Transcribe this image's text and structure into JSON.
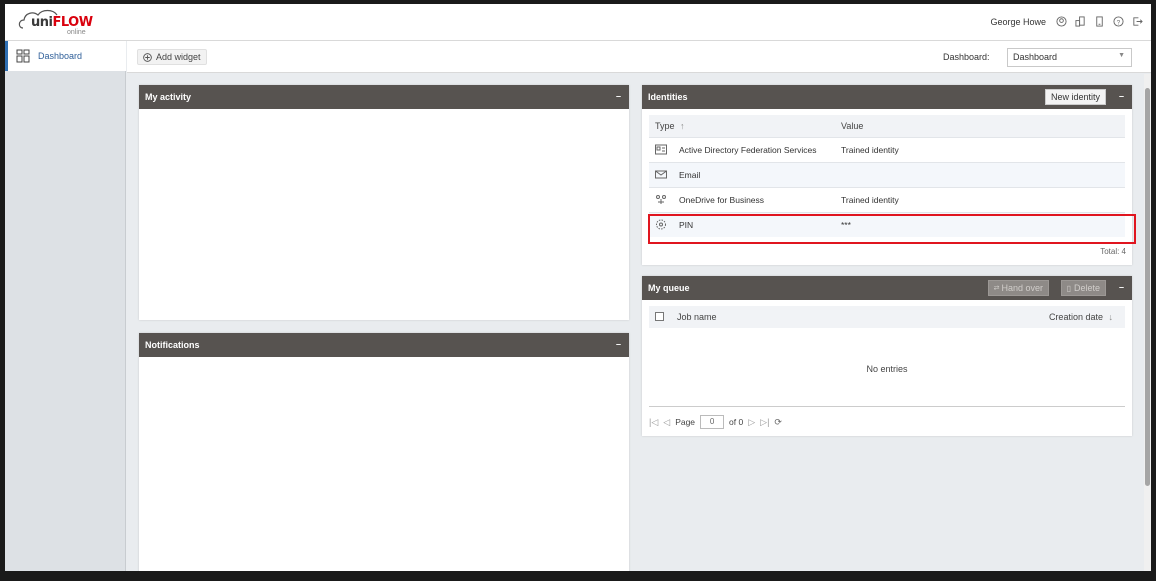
{
  "app": {
    "logo_main": "uni",
    "logo_flow": "FLOW",
    "logo_sub": "online"
  },
  "header": {
    "user_name": "George Howe",
    "icons": [
      "user-circle-icon",
      "devices-icon",
      "device-icon",
      "help-icon",
      "logout-icon"
    ]
  },
  "sidebar": {
    "items": [
      {
        "label": "Dashboard",
        "icon": "dashboard-grid-icon",
        "active": true
      }
    ]
  },
  "toolbar": {
    "add_widget_label": "Add widget",
    "dashboard_label": "Dashboard:",
    "dashboard_selected": "Dashboard"
  },
  "widgets": {
    "activity": {
      "title": "My activity",
      "collapse": "–"
    },
    "notifications": {
      "title": "Notifications",
      "collapse": "–"
    },
    "identities": {
      "title": "Identities",
      "new_button": "New identity",
      "collapse": "–",
      "columns": [
        "Type",
        "Value"
      ],
      "sort_indicator": "↑",
      "rows": [
        {
          "icon": "id-card-icon",
          "type": "Active Directory Federation Services",
          "value": "Trained identity"
        },
        {
          "icon": "email-icon",
          "type": "Email",
          "value": ""
        },
        {
          "icon": "onedrive-icon",
          "type": "OneDrive for Business",
          "value": "Trained identity"
        },
        {
          "icon": "pin-icon",
          "type": "PIN",
          "value": "***"
        }
      ],
      "total": "Total: 4"
    },
    "queue": {
      "title": "My queue",
      "handover_button": "Hand over",
      "delete_button": "Delete",
      "collapse": "–",
      "columns": [
        "Job name",
        "Creation date"
      ],
      "sort_indicator": "↓",
      "empty_text": "No entries",
      "pager": {
        "page_label": "Page",
        "page_value": "0",
        "of_label": "of 0"
      }
    }
  },
  "colors": {
    "widget_header": "#575350",
    "accent": "#2f6fb3",
    "highlight": "#e0151f",
    "brand_red": "#d9000d"
  }
}
